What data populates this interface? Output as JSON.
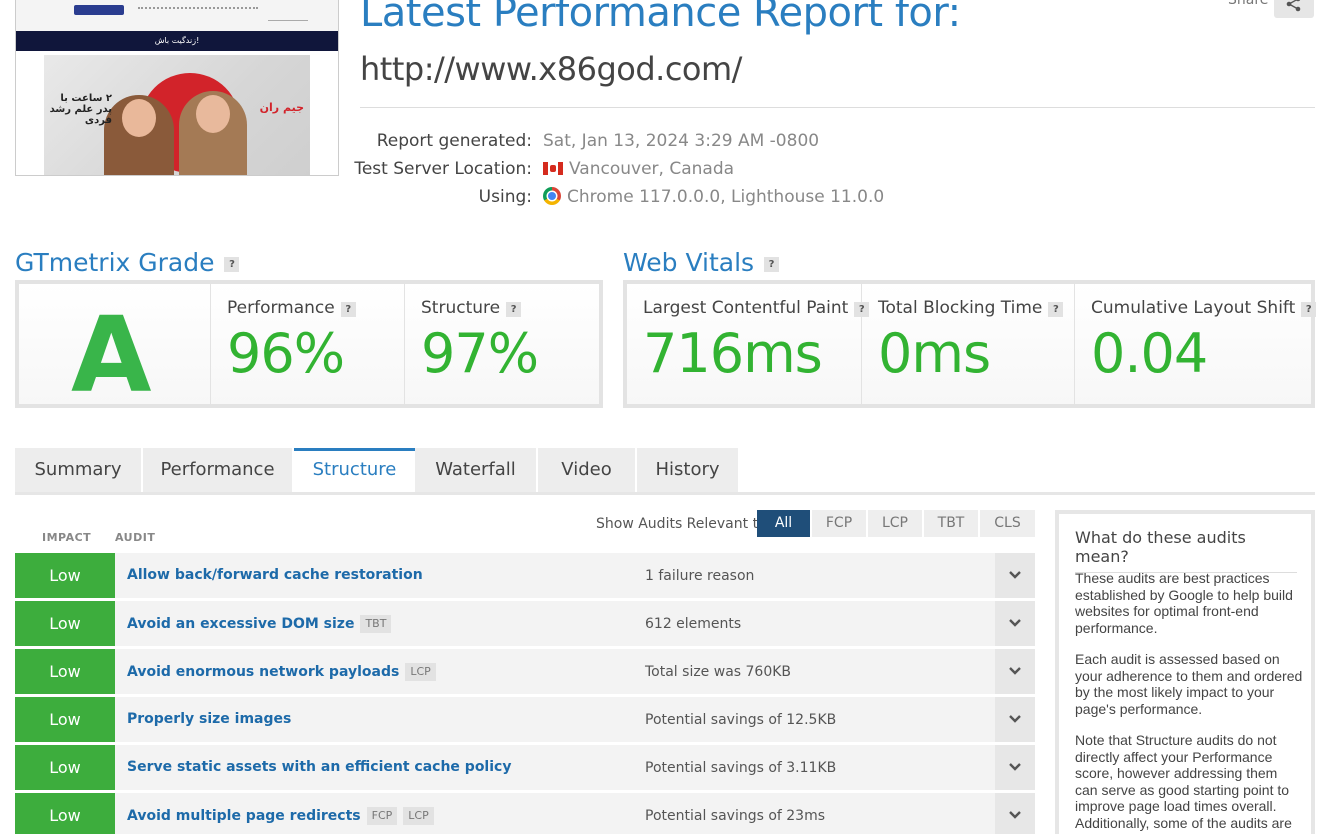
{
  "header": {
    "title": "Latest Performance Report for:",
    "url": "http://www.x86god.com/",
    "share_label": "Share",
    "thumbnail_banner_text": "زندگیت باش!",
    "thumbnail_headline_1": "۲ ساعت با پدر علم رشد فردی",
    "thumbnail_headline_2": "جیم ران"
  },
  "report_info": {
    "generated_label": "Report generated:",
    "generated_value": "Sat, Jan 13, 2024 3:29 AM -0800",
    "location_label": "Test Server Location:",
    "location_value": "Vancouver, Canada",
    "using_label": "Using:",
    "using_value": "Chrome 117.0.0.0, Lighthouse 11.0.0"
  },
  "grade": {
    "title": "GTmetrix Grade",
    "letter": "A",
    "performance_label": "Performance",
    "performance_value": "96%",
    "structure_label": "Structure",
    "structure_value": "97%"
  },
  "vitals": {
    "title": "Web Vitals",
    "lcp_label": "Largest Contentful Paint",
    "lcp_value": "716ms",
    "tbt_label": "Total Blocking Time",
    "tbt_value": "0ms",
    "cls_label": "Cumulative Layout Shift",
    "cls_value": "0.04"
  },
  "tabs": [
    "Summary",
    "Performance",
    "Structure",
    "Waterfall",
    "Video",
    "History"
  ],
  "active_tab": "Structure",
  "audits": {
    "impact_header": "IMPACT",
    "audit_header": "AUDIT",
    "show_label": "Show Audits Relevant to",
    "filters": [
      "All",
      "FCP",
      "LCP",
      "TBT",
      "CLS"
    ],
    "active_filter": "All",
    "rows": [
      {
        "impact": "Low",
        "name": "Allow back/forward cache restoration",
        "tags": [],
        "detail": "1 failure reason"
      },
      {
        "impact": "Low",
        "name": "Avoid an excessive DOM size",
        "tags": [
          "TBT"
        ],
        "detail": "612 elements"
      },
      {
        "impact": "Low",
        "name": "Avoid enormous network payloads",
        "tags": [
          "LCP"
        ],
        "detail": "Total size was 760KB"
      },
      {
        "impact": "Low",
        "name": "Properly size images",
        "tags": [],
        "detail": "Potential savings of 12.5KB"
      },
      {
        "impact": "Low",
        "name": "Serve static assets with an efficient cache policy",
        "tags": [],
        "detail": "Potential savings of 3.11KB"
      },
      {
        "impact": "Low",
        "name": "Avoid multiple page redirects",
        "tags": [
          "FCP",
          "LCP"
        ],
        "detail": "Potential savings of 23ms"
      }
    ]
  },
  "sidebox": {
    "title": "What do these audits mean?",
    "p1": "These audits are best practices established by Google to help build websites for optimal front-end performance.",
    "p2": "Each audit is assessed based on your adherence to them and ordered by the most likely impact to your page's performance.",
    "p3": "Note that Structure audits do not directly affect your Performance score, however addressing them can serve as good starting point to improve page load times overall. Additionally, some of the audits are correlated and thus, fixing one"
  },
  "colors": {
    "accent": "#2a7ec0",
    "good": "#32b332",
    "impact_low": "#3dad3d",
    "filter_active": "#1f4e79"
  }
}
